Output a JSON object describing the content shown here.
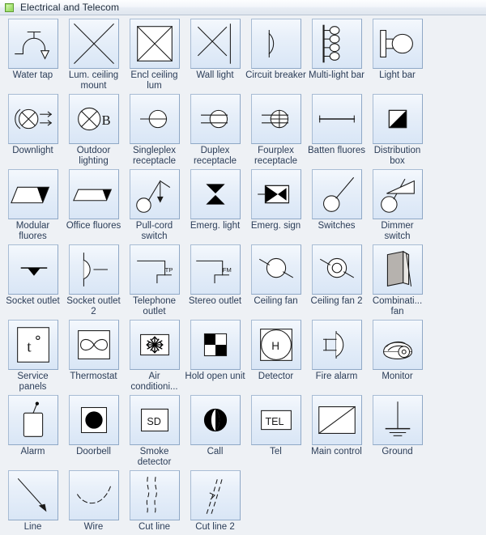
{
  "window": {
    "title": "Electrical and Telecom",
    "icon": "green-square-icon",
    "accent_color": "#9fe06a",
    "background_color": "#eef1f5",
    "tile_border_color": "#a8bcd4",
    "label_color": "#2b3d58"
  },
  "stencil": {
    "columns": 8,
    "rows": 7,
    "count": 54,
    "items": [
      {
        "id": "water-tap",
        "label": "Water tap",
        "icon": "water-tap-symbol"
      },
      {
        "id": "lum-ceiling-mount",
        "label": "Lum. ceiling mount",
        "icon": "x-cross-symbol"
      },
      {
        "id": "encl-ceiling-lum",
        "label": "Encl ceiling lum",
        "icon": "boxed-x-cross-symbol"
      },
      {
        "id": "wall-light",
        "label": "Wall light",
        "icon": "x-cross-with-wall-line-symbol"
      },
      {
        "id": "circuit-breaker",
        "label": "Circuit breaker",
        "icon": "circuit-breaker-symbol"
      },
      {
        "id": "multi-light-bar",
        "label": "Multi-light bar",
        "icon": "multi-light-bar-symbol"
      },
      {
        "id": "light-bar",
        "label": "Light bar",
        "icon": "light-bar-symbol"
      },
      {
        "id": "downlight",
        "label": "Downlight",
        "icon": "downlight-symbol"
      },
      {
        "id": "outdoor-lighting",
        "label": "Outdoor lighting",
        "icon": "circled-x-with-b-symbol"
      },
      {
        "id": "singleplex-receptacle",
        "label": "Singleplex receptacle",
        "icon": "singleplex-receptacle-symbol"
      },
      {
        "id": "duplex-receptacle",
        "label": "Duplex receptacle",
        "icon": "duplex-receptacle-symbol"
      },
      {
        "id": "fourplex-receptacle",
        "label": "Fourplex receptacle",
        "icon": "fourplex-receptacle-symbol"
      },
      {
        "id": "batten-fluores",
        "label": "Batten fluores",
        "icon": "batten-fluorescent-symbol"
      },
      {
        "id": "distribution-box",
        "label": "Distribution box",
        "icon": "distribution-box-symbol"
      },
      {
        "id": "modular-fluores",
        "label": "Modular fluores",
        "icon": "modular-fluorescent-symbol"
      },
      {
        "id": "office-fluores",
        "label": "Office fluores",
        "icon": "office-fluorescent-symbol"
      },
      {
        "id": "pull-cord-switch",
        "label": "Pull-cord switch",
        "icon": "pull-cord-switch-symbol"
      },
      {
        "id": "emerg-light",
        "label": "Emerg. light",
        "icon": "bowtie-symbol"
      },
      {
        "id": "emerg-sign",
        "label": "Emerg. sign",
        "icon": "emergency-sign-symbol"
      },
      {
        "id": "switches",
        "label": "Switches",
        "icon": "switch-symbol"
      },
      {
        "id": "dimmer-switch",
        "label": "Dimmer switch",
        "icon": "dimmer-switch-symbol"
      },
      {
        "id": "socket-outlet",
        "label": "Socket outlet",
        "icon": "socket-outlet-symbol"
      },
      {
        "id": "socket-outlet-2",
        "label": "Socket outlet 2",
        "icon": "socket-outlet-2-symbol"
      },
      {
        "id": "telephone-outlet",
        "label": "Telephone outlet",
        "icon": "telephone-outlet-symbol",
        "annotation": "TP"
      },
      {
        "id": "stereo-outlet",
        "label": "Stereo outlet",
        "icon": "stereo-outlet-symbol",
        "annotation": "FM"
      },
      {
        "id": "ceiling-fan",
        "label": "Ceiling fan",
        "icon": "ceiling-fan-symbol"
      },
      {
        "id": "ceiling-fan-2",
        "label": "Ceiling fan 2",
        "icon": "ceiling-fan-2-symbol"
      },
      {
        "id": "combination-fan",
        "label": "Combinati... fan",
        "icon": "combination-fan-symbol"
      },
      {
        "id": "service-panels",
        "label": "Service panels",
        "icon": "service-panel-symbol",
        "annotation": "t °"
      },
      {
        "id": "thermostat",
        "label": "Thermostat",
        "icon": "thermostat-infinity-symbol"
      },
      {
        "id": "air-conditioning",
        "label": "Air conditioni...",
        "icon": "snowflake-symbol"
      },
      {
        "id": "hold-open-unit",
        "label": "Hold open unit",
        "icon": "checkerboard-symbol"
      },
      {
        "id": "detector",
        "label": "Detector",
        "icon": "detector-symbol",
        "annotation": "H"
      },
      {
        "id": "fire-alarm",
        "label": "Fire alarm",
        "icon": "fire-alarm-symbol"
      },
      {
        "id": "monitor",
        "label": "Monitor",
        "icon": "dome-camera-symbol"
      },
      {
        "id": "alarm",
        "label": "Alarm",
        "icon": "alarm-symbol"
      },
      {
        "id": "doorbell",
        "label": "Doorbell",
        "icon": "doorbell-symbol"
      },
      {
        "id": "smoke-detector",
        "label": "Smoke detector",
        "icon": "smoke-detector-symbol",
        "annotation": "SD"
      },
      {
        "id": "call",
        "label": "Call",
        "icon": "call-symbol"
      },
      {
        "id": "tel",
        "label": "Tel",
        "icon": "tel-symbol",
        "annotation": "TEL"
      },
      {
        "id": "main-control",
        "label": "Main control",
        "icon": "main-control-symbol"
      },
      {
        "id": "ground",
        "label": "Ground",
        "icon": "ground-symbol"
      },
      {
        "id": "line",
        "label": "Line",
        "icon": "arrow-line-symbol"
      },
      {
        "id": "wire",
        "label": "Wire",
        "icon": "dashed-wire-symbol"
      },
      {
        "id": "cut-line",
        "label": "Cut line",
        "icon": "cut-line-symbol"
      },
      {
        "id": "cut-line-2",
        "label": "Cut line 2",
        "icon": "cut-line-2-symbol"
      }
    ]
  }
}
